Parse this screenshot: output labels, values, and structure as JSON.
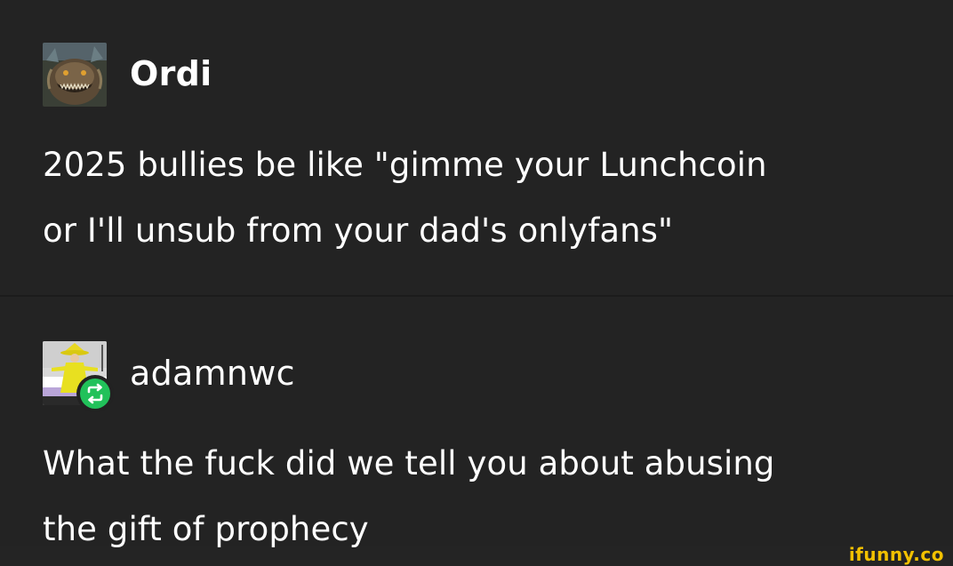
{
  "posts": [
    {
      "username": "Ordi",
      "avatar_icon": "dragon-avatar-icon",
      "text": "2025 bullies be like \"gimme your Lunchcoin\nor I'll unsub from your dad's onlyfans\""
    },
    {
      "username": "adamnwc",
      "avatar_icon": "costume-avatar-icon",
      "reblog_icon": "reblog-icon",
      "text": "What the fuck did we tell you about abusing\nthe gift of prophecy"
    }
  ],
  "watermark": "ifunny.co",
  "colors": {
    "background": "#232323",
    "text": "#ffffff",
    "reblog_badge": "#21c15a",
    "watermark": "#f2c100"
  }
}
